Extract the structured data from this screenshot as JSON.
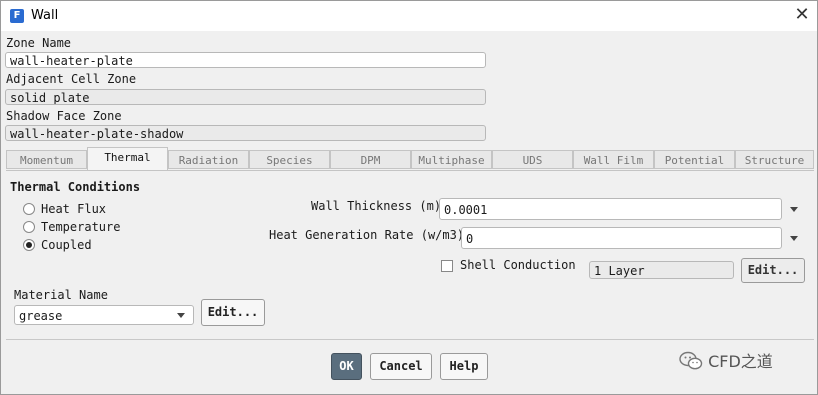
{
  "window": {
    "title": "Wall",
    "icon_letter": "F"
  },
  "zone_name": {
    "label": "Zone Name",
    "value": "wall-heater-plate"
  },
  "adjacent_cell_zone": {
    "label": "Adjacent Cell Zone",
    "value": "solid_plate"
  },
  "shadow_face_zone": {
    "label": "Shadow Face Zone",
    "value": "wall-heater-plate-shadow"
  },
  "tabs": [
    "Momentum",
    "Thermal",
    "Radiation",
    "Species",
    "DPM",
    "Multiphase",
    "UDS",
    "Wall Film",
    "Potential",
    "Structure"
  ],
  "active_tab": "Thermal",
  "thermal": {
    "heading": "Thermal Conditions",
    "options": [
      "Heat Flux",
      "Temperature",
      "Coupled"
    ],
    "selected": "Coupled",
    "wall_thickness": {
      "label": "Wall Thickness (m)",
      "value": "0.0001"
    },
    "heat_generation": {
      "label": "Heat Generation Rate (w/m3)",
      "value": "0"
    },
    "shell_conduction": {
      "label": "Shell Conduction",
      "checked": false,
      "layers": "1 Layer",
      "edit_label": "Edit..."
    },
    "material": {
      "label": "Material Name",
      "value": "grease",
      "edit_label": "Edit..."
    }
  },
  "buttons": {
    "ok": "OK",
    "cancel": "Cancel",
    "help": "Help"
  },
  "watermark": "CFD之道",
  "colors": {
    "primary_button": "#5a6e7e",
    "app_icon": "#2a6bd1"
  }
}
